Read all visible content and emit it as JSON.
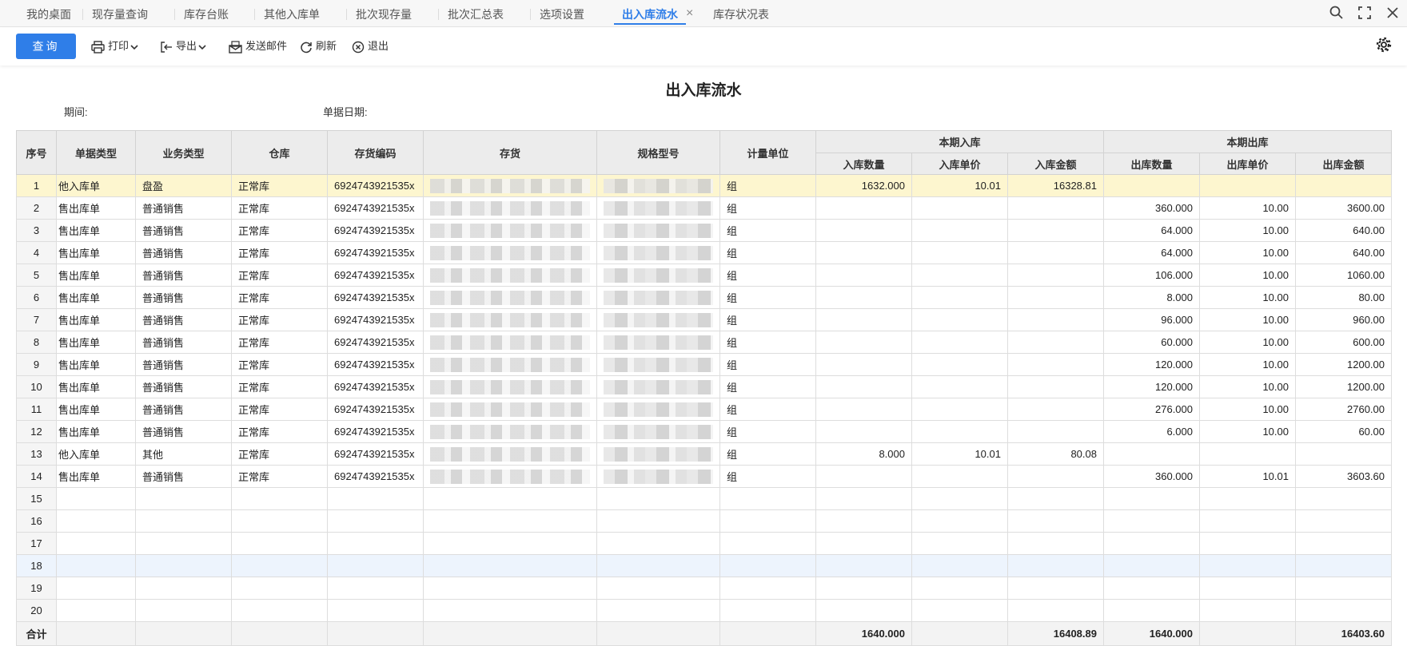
{
  "tabs": [
    {
      "label": "我的桌面",
      "active": false
    },
    {
      "label": "现存量查询",
      "active": false
    },
    {
      "label": "库存台账",
      "active": false
    },
    {
      "label": "其他入库单",
      "active": false
    },
    {
      "label": "批次现存量",
      "active": false
    },
    {
      "label": "批次汇总表",
      "active": false
    },
    {
      "label": "选项设置",
      "active": false
    },
    {
      "label": "出入库流水",
      "active": true
    },
    {
      "label": "库存状况表",
      "active": false
    }
  ],
  "tab_close_glyph": "×",
  "window_controls": [
    "search-icon",
    "maximize-icon",
    "close-icon"
  ],
  "toolbar": {
    "query": "查询",
    "print": "打印",
    "export": "导出",
    "send_mail": "发送邮件",
    "refresh": "刷新",
    "exit": "退出"
  },
  "report": {
    "title": "出入库流水",
    "period_label": "期间:",
    "doc_date_label": "单据日期:"
  },
  "table": {
    "headers": {
      "seq": "序号",
      "doc_type": "单据类型",
      "biz_type": "业务类型",
      "warehouse": "仓库",
      "item_code": "存货编码",
      "item": "存货",
      "spec": "规格型号",
      "unit": "计量单位",
      "in_group": "本期入库",
      "in_qty": "入库数量",
      "in_price": "入库单价",
      "in_amount": "入库金额",
      "out_group": "本期出库",
      "out_qty": "出库数量",
      "out_price": "出库单价",
      "out_amount": "出库金额"
    },
    "rows": [
      {
        "seq": "1",
        "doc_type": "他入库单",
        "biz_type": "盘盈",
        "warehouse": "正常库",
        "item_code": "6924743921535x",
        "unit": "组",
        "in_qty": "1632.000",
        "in_price": "10.01",
        "in_amount": "16328.81",
        "out_qty": "",
        "out_price": "",
        "out_amount": ""
      },
      {
        "seq": "2",
        "doc_type": "售出库单",
        "biz_type": "普通销售",
        "warehouse": "正常库",
        "item_code": "6924743921535x",
        "unit": "组",
        "in_qty": "",
        "in_price": "",
        "in_amount": "",
        "out_qty": "360.000",
        "out_price": "10.00",
        "out_amount": "3600.00"
      },
      {
        "seq": "3",
        "doc_type": "售出库单",
        "biz_type": "普通销售",
        "warehouse": "正常库",
        "item_code": "6924743921535x",
        "unit": "组",
        "in_qty": "",
        "in_price": "",
        "in_amount": "",
        "out_qty": "64.000",
        "out_price": "10.00",
        "out_amount": "640.00"
      },
      {
        "seq": "4",
        "doc_type": "售出库单",
        "biz_type": "普通销售",
        "warehouse": "正常库",
        "item_code": "6924743921535x",
        "unit": "组",
        "in_qty": "",
        "in_price": "",
        "in_amount": "",
        "out_qty": "64.000",
        "out_price": "10.00",
        "out_amount": "640.00"
      },
      {
        "seq": "5",
        "doc_type": "售出库单",
        "biz_type": "普通销售",
        "warehouse": "正常库",
        "item_code": "6924743921535x",
        "unit": "组",
        "in_qty": "",
        "in_price": "",
        "in_amount": "",
        "out_qty": "106.000",
        "out_price": "10.00",
        "out_amount": "1060.00"
      },
      {
        "seq": "6",
        "doc_type": "售出库单",
        "biz_type": "普通销售",
        "warehouse": "正常库",
        "item_code": "6924743921535x",
        "unit": "组",
        "in_qty": "",
        "in_price": "",
        "in_amount": "",
        "out_qty": "8.000",
        "out_price": "10.00",
        "out_amount": "80.00"
      },
      {
        "seq": "7",
        "doc_type": "售出库单",
        "biz_type": "普通销售",
        "warehouse": "正常库",
        "item_code": "6924743921535x",
        "unit": "组",
        "in_qty": "",
        "in_price": "",
        "in_amount": "",
        "out_qty": "96.000",
        "out_price": "10.00",
        "out_amount": "960.00"
      },
      {
        "seq": "8",
        "doc_type": "售出库单",
        "biz_type": "普通销售",
        "warehouse": "正常库",
        "item_code": "6924743921535x",
        "unit": "组",
        "in_qty": "",
        "in_price": "",
        "in_amount": "",
        "out_qty": "60.000",
        "out_price": "10.00",
        "out_amount": "600.00"
      },
      {
        "seq": "9",
        "doc_type": "售出库单",
        "biz_type": "普通销售",
        "warehouse": "正常库",
        "item_code": "6924743921535x",
        "unit": "组",
        "in_qty": "",
        "in_price": "",
        "in_amount": "",
        "out_qty": "120.000",
        "out_price": "10.00",
        "out_amount": "1200.00"
      },
      {
        "seq": "10",
        "doc_type": "售出库单",
        "biz_type": "普通销售",
        "warehouse": "正常库",
        "item_code": "6924743921535x",
        "unit": "组",
        "in_qty": "",
        "in_price": "",
        "in_amount": "",
        "out_qty": "120.000",
        "out_price": "10.00",
        "out_amount": "1200.00"
      },
      {
        "seq": "11",
        "doc_type": "售出库单",
        "biz_type": "普通销售",
        "warehouse": "正常库",
        "item_code": "6924743921535x",
        "unit": "组",
        "in_qty": "",
        "in_price": "",
        "in_amount": "",
        "out_qty": "276.000",
        "out_price": "10.00",
        "out_amount": "2760.00"
      },
      {
        "seq": "12",
        "doc_type": "售出库单",
        "biz_type": "普通销售",
        "warehouse": "正常库",
        "item_code": "6924743921535x",
        "unit": "组",
        "in_qty": "",
        "in_price": "",
        "in_amount": "",
        "out_qty": "6.000",
        "out_price": "10.00",
        "out_amount": "60.00"
      },
      {
        "seq": "13",
        "doc_type": "他入库单",
        "biz_type": "其他",
        "warehouse": "正常库",
        "item_code": "6924743921535x",
        "unit": "组",
        "in_qty": "8.000",
        "in_price": "10.01",
        "in_amount": "80.08",
        "out_qty": "",
        "out_price": "",
        "out_amount": ""
      },
      {
        "seq": "14",
        "doc_type": "售出库单",
        "biz_type": "普通销售",
        "warehouse": "正常库",
        "item_code": "6924743921535x",
        "unit": "组",
        "in_qty": "",
        "in_price": "",
        "in_amount": "",
        "out_qty": "360.000",
        "out_price": "10.01",
        "out_amount": "3603.60"
      },
      {
        "seq": "15"
      },
      {
        "seq": "16"
      },
      {
        "seq": "17"
      },
      {
        "seq": "18"
      },
      {
        "seq": "19"
      },
      {
        "seq": "20"
      }
    ],
    "total": {
      "label": "合计",
      "in_qty": "1640.000",
      "in_amount": "16408.89",
      "out_qty": "1640.000",
      "out_amount": "16403.60"
    }
  },
  "colors": {
    "accent": "#2f7ee8",
    "selected_row": "#fdf6cf",
    "hover_row": "#edf4fd"
  }
}
